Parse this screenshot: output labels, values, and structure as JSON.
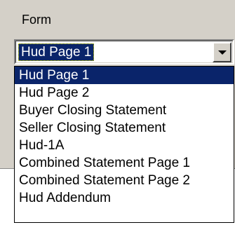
{
  "form": {
    "label": "Form",
    "selected_value": "Hud Page 1",
    "options": [
      "Hud Page 1",
      "Hud Page 2",
      "Buyer Closing Statement",
      "Seller Closing Statement",
      "Hud-1A",
      "Combined Statement Page 1",
      "Combined Statement Page 2",
      "Hud Addendum"
    ],
    "highlighted_index": 0,
    "dropdown_icon": "chevron-down-icon"
  },
  "colors": {
    "panel_background": "#d4d0c8",
    "selection_background": "#0a246a",
    "selection_text": "#ffffff"
  }
}
